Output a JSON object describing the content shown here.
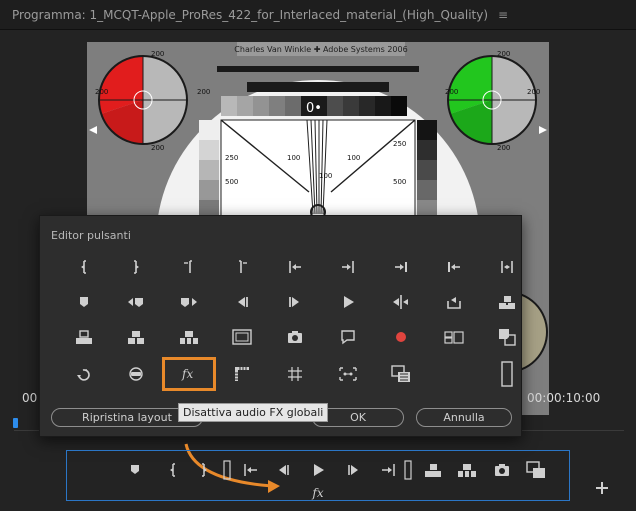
{
  "panel": {
    "title": "Programma: 1_MCQT-Apple_ProRes_422_for_Interlaced_material_(High_Quality)",
    "menu_glyph": "≡"
  },
  "monitor": {
    "credit": "Charles Van Winkle ✚ Adobe Systems 2006",
    "readout": "0•",
    "labels": [
      "200",
      "200",
      "200",
      "200",
      "200",
      "200",
      "200",
      "200",
      "250",
      "500",
      "100",
      "100",
      "250",
      "500",
      "100"
    ]
  },
  "timecodes": {
    "start": "00",
    "end": "00:00:10:00"
  },
  "button_editor": {
    "title": "Editor pulsanti",
    "highlight_color": "#e8892a",
    "icons": [
      "mark-in-icon",
      "mark-out-icon",
      "mark-clip-in-icon",
      "mark-clip-out-icon",
      "go-to-in-icon",
      "go-to-out-icon",
      "go-to-next-edit-icon",
      "go-to-previous-edit-icon",
      "clear-in-out-icon",
      "add-marker-icon",
      "go-to-next-marker-icon",
      "go-to-previous-marker-icon",
      "step-back-icon",
      "step-forward-icon",
      "play-icon",
      "trim-icon",
      "export-frame-icon",
      "insert-icon",
      "lift-icon",
      "extract-icon",
      "overwrite-icon",
      "safe-margins-icon",
      "camera-icon",
      "comment-icon",
      "record-icon",
      "multi-camera-icon",
      "compare-icon",
      "loop-icon",
      "vr-video-icon",
      "fx-icon",
      "show-rulers-icon",
      "show-guides-icon",
      "snap-icon",
      "proxy-icon",
      "spacer-icon"
    ],
    "reset_label": "Ripristina layout",
    "ok_label": "OK",
    "cancel_label": "Annulla",
    "tooltip": "Disattiva audio FX globali"
  },
  "transport": {
    "icons": [
      "add-marker-icon",
      "mark-in-icon",
      "mark-out-icon",
      "spacer-icon",
      "go-to-in-icon",
      "step-back-icon",
      "play-icon",
      "step-forward-icon",
      "go-to-out-icon",
      "spacer-icon",
      "insert-icon",
      "overwrite-icon",
      "camera-icon",
      "proxy-icon"
    ],
    "fx_label": "fx"
  },
  "colors": {
    "accent_blue": "#2b76c6",
    "highlight_orange": "#e8892a",
    "record_red": "#e0443e"
  }
}
